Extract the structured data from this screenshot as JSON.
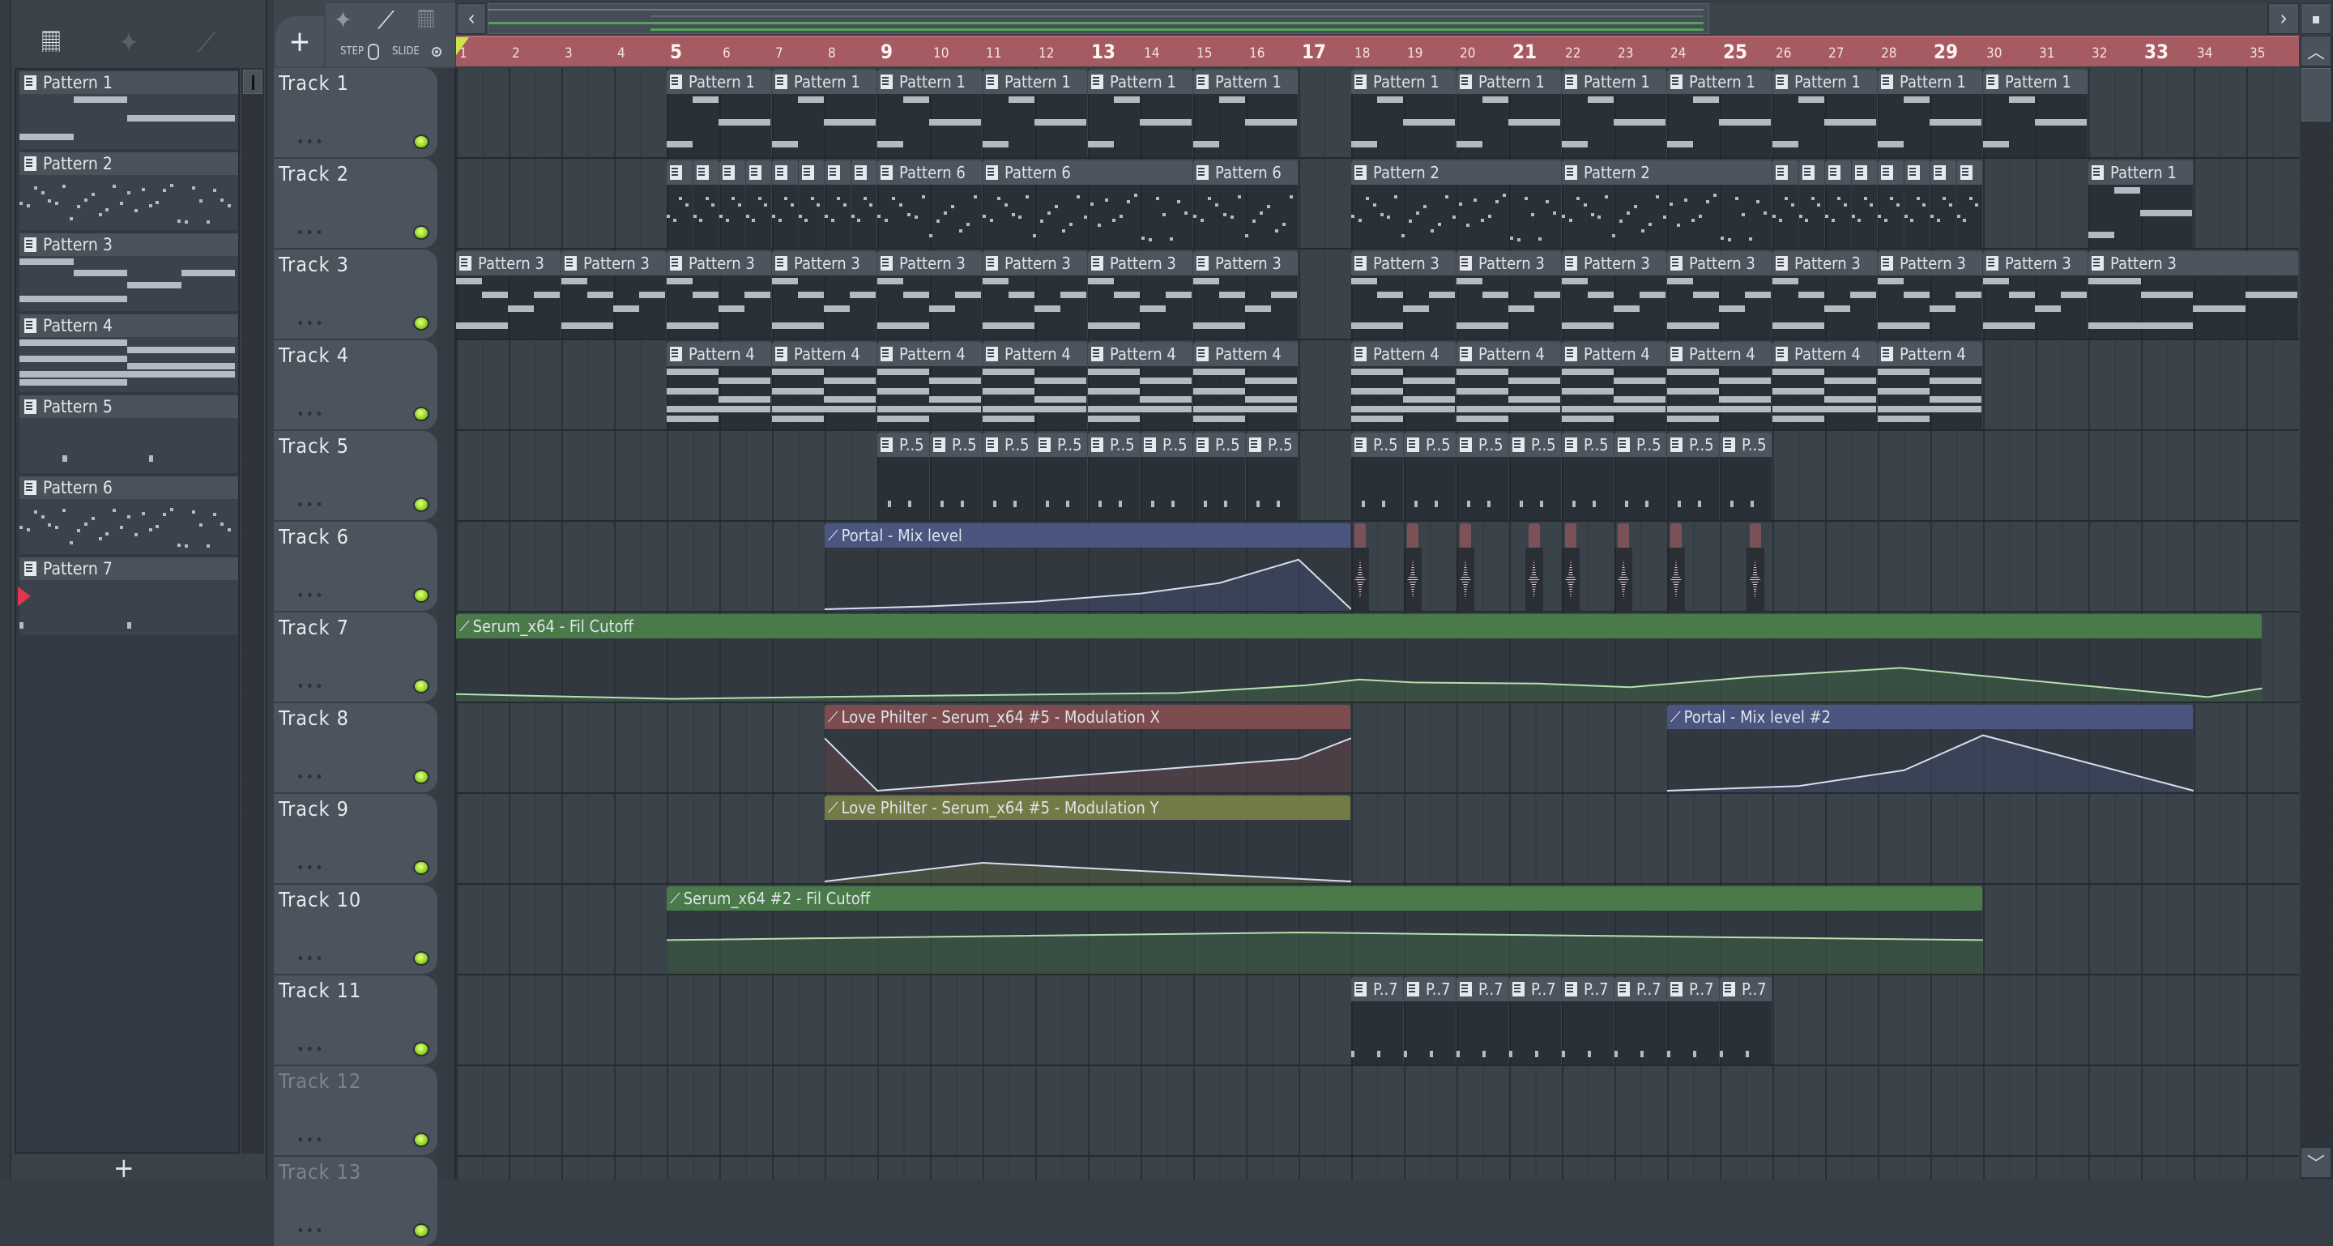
{
  "toolbar": {
    "add_label": "+",
    "step_label": "STEP",
    "slide_label": "SLIDE",
    "scroll_left": "‹",
    "scroll_right": "›"
  },
  "pattern_panel": {
    "add_label": "+",
    "patterns": [
      {
        "label": "Pattern 1",
        "preview": "p1"
      },
      {
        "label": "Pattern 2",
        "preview": "dots"
      },
      {
        "label": "Pattern 3",
        "preview": "p3"
      },
      {
        "label": "Pattern 4",
        "preview": "p4"
      },
      {
        "label": "Pattern 5",
        "preview": "p5"
      },
      {
        "label": "Pattern 6",
        "preview": "dots"
      },
      {
        "label": "Pattern 7",
        "preview": "p7"
      }
    ]
  },
  "ruler": {
    "bars": [
      "1",
      "2",
      "3",
      "4",
      "5",
      "6",
      "7",
      "8",
      "9",
      "10",
      "11",
      "12",
      "13",
      "14",
      "15",
      "16",
      "17",
      "18",
      "19",
      "20",
      "21",
      "22",
      "23",
      "24",
      "25",
      "26",
      "27",
      "28",
      "29",
      "30",
      "31",
      "32",
      "33",
      "34",
      "35"
    ]
  },
  "colors": {
    "ruler": "#a65a61",
    "auto_blue": "#4a5580",
    "auto_green": "#4a7a4a",
    "auto_red": "#7d4c4f",
    "auto_olive": "#737a45",
    "led": "#8fd61f"
  },
  "tracks": [
    {
      "name": "Track 1",
      "clips": [
        {
          "l": "Pattern 1",
          "s": 5,
          "n": 2,
          "p": "p1"
        },
        {
          "l": "Pattern 1",
          "s": 7,
          "n": 2,
          "p": "p1"
        },
        {
          "l": "Pattern 1",
          "s": 9,
          "n": 2,
          "p": "p1"
        },
        {
          "l": "Pattern 1",
          "s": 11,
          "n": 2,
          "p": "p1"
        },
        {
          "l": "Pattern 1",
          "s": 13,
          "n": 2,
          "p": "p1"
        },
        {
          "l": "Pattern 1",
          "s": 15,
          "n": 2,
          "p": "p1"
        },
        {
          "l": "Pattern 1",
          "s": 18,
          "n": 2,
          "p": "p1"
        },
        {
          "l": "Pattern 1",
          "s": 20,
          "n": 2,
          "p": "p1"
        },
        {
          "l": "Pattern 1",
          "s": 22,
          "n": 2,
          "p": "p1"
        },
        {
          "l": "Pattern 1",
          "s": 24,
          "n": 2,
          "p": "p1"
        },
        {
          "l": "Pattern 1",
          "s": 26,
          "n": 2,
          "p": "p1"
        },
        {
          "l": "Pattern 1",
          "s": 28,
          "n": 2,
          "p": "p1"
        },
        {
          "l": "Pattern 1",
          "s": 30,
          "n": 2,
          "p": "p1"
        }
      ]
    },
    {
      "name": "Track 2",
      "clips": [
        {
          "l": "",
          "s": 5,
          "n": 0.5,
          "p": "dots"
        },
        {
          "l": "",
          "s": 5.5,
          "n": 0.5,
          "p": "dots"
        },
        {
          "l": "",
          "s": 6,
          "n": 0.5,
          "p": "dots"
        },
        {
          "l": "",
          "s": 6.5,
          "n": 0.5,
          "p": "dots"
        },
        {
          "l": "",
          "s": 7,
          "n": 0.5,
          "p": "dots"
        },
        {
          "l": "",
          "s": 7.5,
          "n": 0.5,
          "p": "dots"
        },
        {
          "l": "",
          "s": 8,
          "n": 0.5,
          "p": "dots"
        },
        {
          "l": "",
          "s": 8.5,
          "n": 0.5,
          "p": "dots"
        },
        {
          "l": "Pattern 6",
          "s": 9,
          "n": 2,
          "p": "dots"
        },
        {
          "l": "Pattern 6",
          "s": 11,
          "n": 4,
          "p": "dots"
        },
        {
          "l": "Pattern 6",
          "s": 15,
          "n": 2,
          "p": "dots"
        },
        {
          "l": "Pattern 2",
          "s": 18,
          "n": 4,
          "p": "dots"
        },
        {
          "l": "Pattern 2",
          "s": 22,
          "n": 4,
          "p": "dots"
        },
        {
          "l": "",
          "s": 26,
          "n": 0.5,
          "p": "dots"
        },
        {
          "l": "",
          "s": 26.5,
          "n": 0.5,
          "p": "dots"
        },
        {
          "l": "",
          "s": 27,
          "n": 0.5,
          "p": "dots"
        },
        {
          "l": "",
          "s": 27.5,
          "n": 0.5,
          "p": "dots"
        },
        {
          "l": "",
          "s": 28,
          "n": 0.5,
          "p": "dots"
        },
        {
          "l": "",
          "s": 28.5,
          "n": 0.5,
          "p": "dots"
        },
        {
          "l": "",
          "s": 29,
          "n": 0.5,
          "p": "dots"
        },
        {
          "l": "",
          "s": 29.5,
          "n": 0.5,
          "p": "dots"
        },
        {
          "l": "Pattern 1",
          "s": 32,
          "n": 2,
          "p": "p1"
        }
      ]
    },
    {
      "name": "Track 3",
      "clips": [
        {
          "l": "Pattern 3",
          "s": 1,
          "n": 2,
          "p": "p3"
        },
        {
          "l": "Pattern 3",
          "s": 3,
          "n": 2,
          "p": "p3"
        },
        {
          "l": "Pattern 3",
          "s": 5,
          "n": 2,
          "p": "p3"
        },
        {
          "l": "Pattern 3",
          "s": 7,
          "n": 2,
          "p": "p3"
        },
        {
          "l": "Pattern 3",
          "s": 9,
          "n": 2,
          "p": "p3"
        },
        {
          "l": "Pattern 3",
          "s": 11,
          "n": 2,
          "p": "p3"
        },
        {
          "l": "Pattern 3",
          "s": 13,
          "n": 2,
          "p": "p3"
        },
        {
          "l": "Pattern 3",
          "s": 15,
          "n": 2,
          "p": "p3"
        },
        {
          "l": "Pattern 3",
          "s": 18,
          "n": 2,
          "p": "p3"
        },
        {
          "l": "Pattern 3",
          "s": 20,
          "n": 2,
          "p": "p3"
        },
        {
          "l": "Pattern 3",
          "s": 22,
          "n": 2,
          "p": "p3"
        },
        {
          "l": "Pattern 3",
          "s": 24,
          "n": 2,
          "p": "p3"
        },
        {
          "l": "Pattern 3",
          "s": 26,
          "n": 2,
          "p": "p3"
        },
        {
          "l": "Pattern 3",
          "s": 28,
          "n": 2,
          "p": "p3"
        },
        {
          "l": "Pattern 3",
          "s": 30,
          "n": 2,
          "p": "p3"
        },
        {
          "l": "Pattern 3",
          "s": 32,
          "n": 4,
          "p": "p3"
        }
      ]
    },
    {
      "name": "Track 4",
      "clips": [
        {
          "l": "Pattern 4",
          "s": 5,
          "n": 2,
          "p": "p4"
        },
        {
          "l": "Pattern 4",
          "s": 7,
          "n": 2,
          "p": "p4"
        },
        {
          "l": "Pattern 4",
          "s": 9,
          "n": 2,
          "p": "p4"
        },
        {
          "l": "Pattern 4",
          "s": 11,
          "n": 2,
          "p": "p4"
        },
        {
          "l": "Pattern 4",
          "s": 13,
          "n": 2,
          "p": "p4"
        },
        {
          "l": "Pattern 4",
          "s": 15,
          "n": 2,
          "p": "p4"
        },
        {
          "l": "Pattern 4",
          "s": 18,
          "n": 2,
          "p": "p4"
        },
        {
          "l": "Pattern 4",
          "s": 20,
          "n": 2,
          "p": "p4"
        },
        {
          "l": "Pattern 4",
          "s": 22,
          "n": 2,
          "p": "p4"
        },
        {
          "l": "Pattern 4",
          "s": 24,
          "n": 2,
          "p": "p4"
        },
        {
          "l": "Pattern 4",
          "s": 26,
          "n": 2,
          "p": "p4"
        },
        {
          "l": "Pattern 4",
          "s": 28,
          "n": 2,
          "p": "p4"
        }
      ]
    },
    {
      "name": "Track 5",
      "clips": [
        {
          "l": "P..5",
          "s": 9,
          "n": 1,
          "p": "p5"
        },
        {
          "l": "P..5",
          "s": 10,
          "n": 1,
          "p": "p5"
        },
        {
          "l": "P..5",
          "s": 11,
          "n": 1,
          "p": "p5"
        },
        {
          "l": "P..5",
          "s": 12,
          "n": 1,
          "p": "p5"
        },
        {
          "l": "P..5",
          "s": 13,
          "n": 1,
          "p": "p5"
        },
        {
          "l": "P..5",
          "s": 14,
          "n": 1,
          "p": "p5"
        },
        {
          "l": "P..5",
          "s": 15,
          "n": 1,
          "p": "p5"
        },
        {
          "l": "P..5",
          "s": 16,
          "n": 1,
          "p": "p5"
        },
        {
          "l": "P..5",
          "s": 18,
          "n": 1,
          "p": "p5"
        },
        {
          "l": "P..5",
          "s": 19,
          "n": 1,
          "p": "p5"
        },
        {
          "l": "P..5",
          "s": 20,
          "n": 1,
          "p": "p5"
        },
        {
          "l": "P..5",
          "s": 21,
          "n": 1,
          "p": "p5"
        },
        {
          "l": "P..5",
          "s": 22,
          "n": 1,
          "p": "p5"
        },
        {
          "l": "P..5",
          "s": 23,
          "n": 1,
          "p": "p5"
        },
        {
          "l": "P..5",
          "s": 24,
          "n": 1,
          "p": "p5"
        },
        {
          "l": "P..5",
          "s": 25,
          "n": 1,
          "p": "p5"
        }
      ]
    },
    {
      "name": "Track 6",
      "clips": [
        {
          "l": "Portal - Mix level",
          "s": 8,
          "n": 10,
          "auto": "#4a5580",
          "pts": [
            [
              0,
              0
            ],
            [
              0.2,
              0.05
            ],
            [
              0.4,
              0.13
            ],
            [
              0.6,
              0.27
            ],
            [
              0.75,
              0.45
            ],
            [
              0.9,
              0.85
            ],
            [
              1,
              0
            ]
          ]
        },
        {
          "audio": true,
          "s": 18,
          "n": 0.3
        },
        {
          "audio": true,
          "s": 19,
          "n": 0.3
        },
        {
          "audio": true,
          "s": 20,
          "n": 0.3
        },
        {
          "audio": true,
          "s": 21.3,
          "n": 0.3
        },
        {
          "audio": true,
          "s": 22,
          "n": 0.3
        },
        {
          "audio": true,
          "s": 23,
          "n": 0.3
        },
        {
          "audio": true,
          "s": 24,
          "n": 0.3
        },
        {
          "audio": true,
          "s": 25.5,
          "n": 0.3
        }
      ]
    },
    {
      "name": "Track 7",
      "clips": [
        {
          "l": "Serum_x64 - Fil Cutoff",
          "s": 1,
          "n": 34.3,
          "auto": "#4a7a4a",
          "pts": [
            [
              0,
              0.1
            ],
            [
              0.12,
              0.02
            ],
            [
              0.25,
              0.07
            ],
            [
              0.4,
              0.12
            ],
            [
              0.47,
              0.25
            ],
            [
              0.5,
              0.35
            ],
            [
              0.53,
              0.3
            ],
            [
              0.6,
              0.28
            ],
            [
              0.65,
              0.22
            ],
            [
              0.72,
              0.4
            ],
            [
              0.8,
              0.55
            ],
            [
              0.9,
              0.25
            ],
            [
              0.97,
              0.05
            ],
            [
              1,
              0.2
            ]
          ]
        }
      ]
    },
    {
      "name": "Track 8",
      "clips": [
        {
          "l": "Love Philter - Serum_x64 #5 - Modulation X",
          "s": 8,
          "n": 10,
          "auto": "#7d4c4f",
          "pts": [
            [
              0,
              0.9
            ],
            [
              0.1,
              0
            ],
            [
              0.9,
              0.55
            ],
            [
              1,
              0.9
            ]
          ]
        },
        {
          "l": "Portal - Mix level #2",
          "s": 24,
          "n": 10,
          "auto": "#4a5580",
          "pts": [
            [
              0,
              0
            ],
            [
              0.25,
              0.08
            ],
            [
              0.45,
              0.35
            ],
            [
              0.6,
              0.95
            ],
            [
              1,
              0
            ]
          ]
        }
      ]
    },
    {
      "name": "Track 9",
      "clips": [
        {
          "l": "Love Philter - Serum_x64 #5 - Modulation Y",
          "s": 8,
          "n": 10,
          "auto": "#737a45",
          "pts": [
            [
              0,
              0
            ],
            [
              0.3,
              0.32
            ],
            [
              0.6,
              0.18
            ],
            [
              1,
              0
            ]
          ]
        }
      ]
    },
    {
      "name": "Track 10",
      "clips": [
        {
          "l": "Serum_x64 #2 - Fil Cutoff",
          "s": 5,
          "n": 25,
          "auto": "#4a7a4a",
          "pts": [
            [
              0,
              0.55
            ],
            [
              0.48,
              0.68
            ],
            [
              1,
              0.55
            ]
          ]
        }
      ]
    },
    {
      "name": "Track 11",
      "clips": [
        {
          "l": "P..7",
          "s": 18,
          "n": 1,
          "p": "p7"
        },
        {
          "l": "P..7",
          "s": 19,
          "n": 1,
          "p": "p7"
        },
        {
          "l": "P..7",
          "s": 20,
          "n": 1,
          "p": "p7"
        },
        {
          "l": "P..7",
          "s": 21,
          "n": 1,
          "p": "p7"
        },
        {
          "l": "P..7",
          "s": 22,
          "n": 1,
          "p": "p7"
        },
        {
          "l": "P..7",
          "s": 23,
          "n": 1,
          "p": "p7"
        },
        {
          "l": "P..7",
          "s": 24,
          "n": 1,
          "p": "p7"
        },
        {
          "l": "P..7",
          "s": 25,
          "n": 1,
          "p": "p7"
        }
      ]
    },
    {
      "name": "Track 12",
      "dim": true,
      "clips": []
    },
    {
      "name": "Track 13",
      "dim": true,
      "clips": []
    }
  ]
}
